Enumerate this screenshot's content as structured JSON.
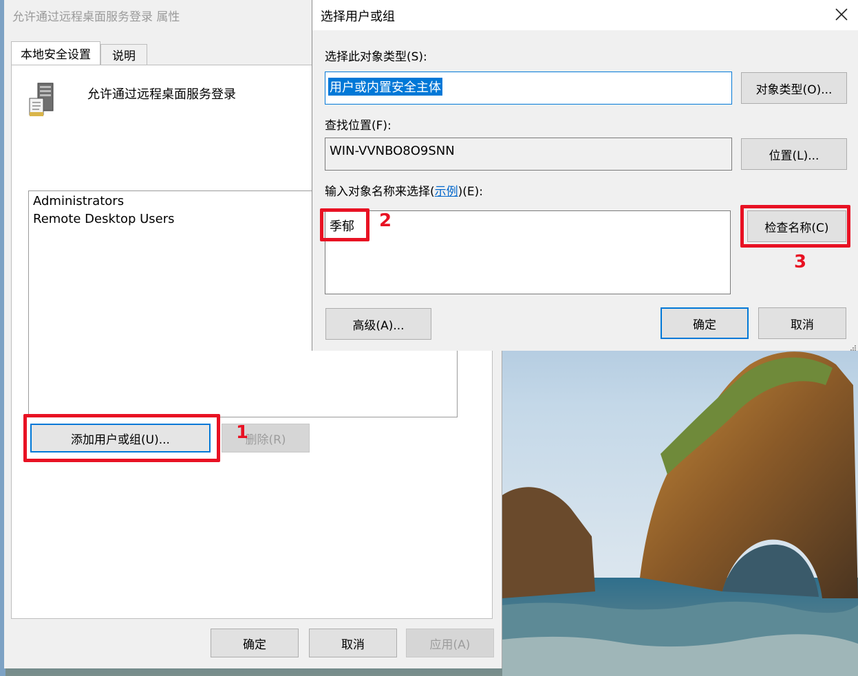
{
  "properties_dialog": {
    "title": "允许通过远程桌面服务登录 属性",
    "tabs": [
      "本地安全设置",
      "说明"
    ],
    "policy_name": "允许通过远程桌面服务登录",
    "members": [
      "Administrators",
      "Remote Desktop Users"
    ],
    "add_button": "添加用户或组(U)...",
    "remove_button": "删除(R)",
    "ok_button": "确定",
    "cancel_button": "取消",
    "apply_button": "应用(A)"
  },
  "select_dialog": {
    "title": "选择用户或组",
    "object_type_label": "选择此对象类型(S):",
    "object_type_value": "用户或内置安全主体",
    "object_type_button": "对象类型(O)...",
    "location_label": "查找位置(F):",
    "location_value": "WIN-VVNBO8O9SNN",
    "location_button": "位置(L)...",
    "names_label_prefix": "输入对象名称来选择(",
    "names_label_link": "示例",
    "names_label_suffix": ")(E):",
    "names_value": "季郁",
    "check_names_button": "检查名称(C)",
    "advanced_button": "高级(A)...",
    "ok_button": "确定",
    "cancel_button": "取消"
  },
  "annotations": {
    "step1": "1",
    "step2": "2",
    "step3": "3",
    "color": "#e81123"
  },
  "colors": {
    "accent": "#0078d7",
    "dialog_bg": "#f0f0f0"
  }
}
